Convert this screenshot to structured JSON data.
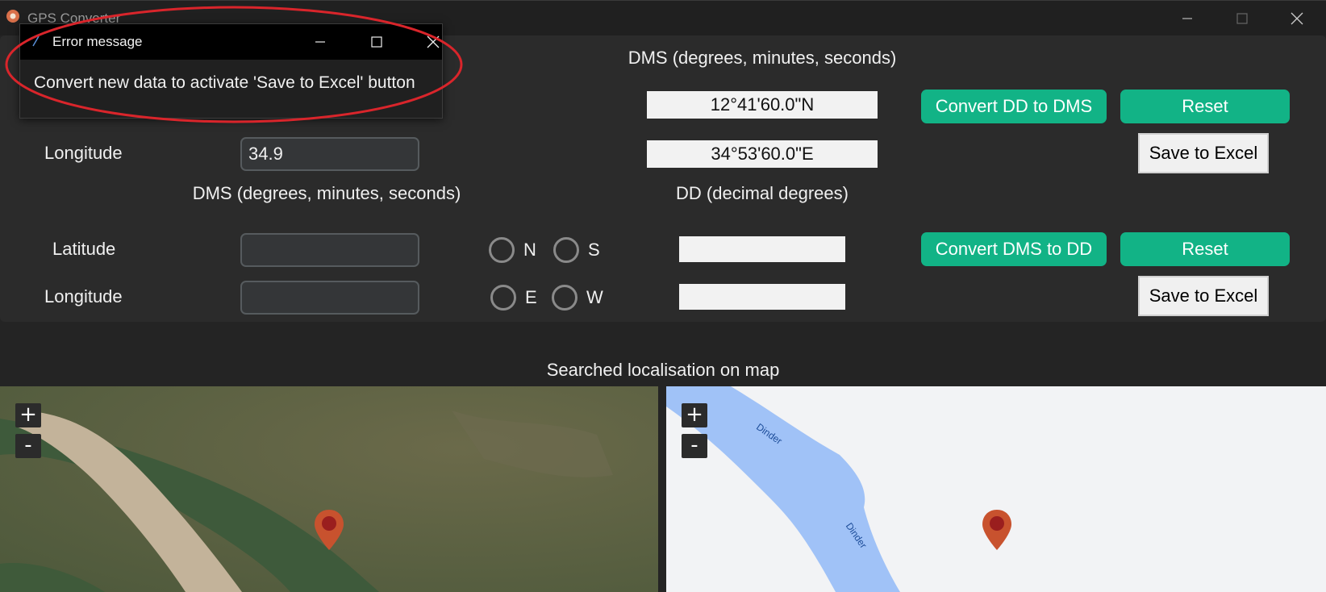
{
  "window": {
    "title": "GPS Converter",
    "controls": {
      "minimize": "—",
      "maximize": "☐",
      "close": "✕"
    }
  },
  "dd_to_dms": {
    "header_right": "DMS (degrees, minutes, seconds)",
    "longitude_label": "Longitude",
    "longitude_value": "34.9",
    "dms_latitude_result": "12°41'60.0\"N",
    "dms_longitude_result": "34°53'60.0\"E",
    "convert_button": "Convert DD to DMS",
    "reset_button": "Reset",
    "save_button": "Save to Excel"
  },
  "dms_to_dd": {
    "header_left": "DMS (degrees, minutes, seconds)",
    "header_right": "DD (decimal degrees)",
    "latitude_label": "Latitude",
    "longitude_label": "Longitude",
    "latitude_value": "",
    "longitude_value": "",
    "radio_n": "N",
    "radio_s": "S",
    "radio_e": "E",
    "radio_w": "W",
    "dd_latitude_result": "",
    "dd_longitude_result": "",
    "convert_button": "Convert DMS to DD",
    "reset_button": "Reset",
    "save_button": "Save to Excel"
  },
  "map": {
    "heading": "Searched localisation on map",
    "zoom_in": "+",
    "zoom_out": "-",
    "river_label_1": "Dinder",
    "river_label_2": "Dinder"
  },
  "error_dialog": {
    "title": "Error message",
    "message": "Convert new data to activate 'Save to Excel' button"
  },
  "colors": {
    "accent_button": "#12b386",
    "annotation_ellipse": "#d9252b",
    "marker": "#c8522e",
    "river": "#a0c2f7"
  }
}
